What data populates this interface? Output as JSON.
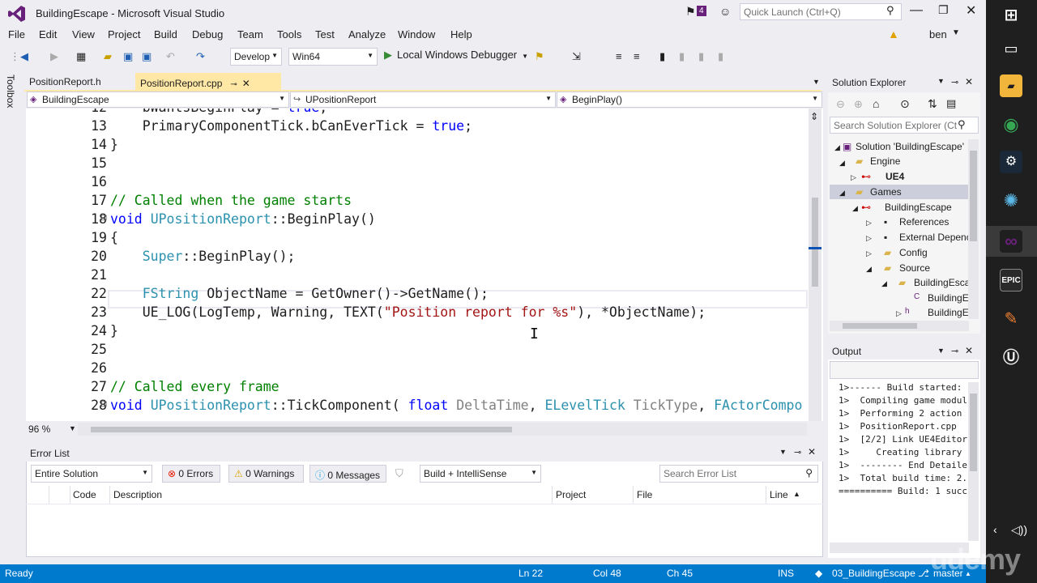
{
  "window": {
    "title": "BuildingEscape - Microsoft Visual Studio",
    "notification_count": "4",
    "quick_launch_placeholder": "Quick Launch (Ctrl+Q)",
    "user": "ben"
  },
  "menu": [
    "File",
    "Edit",
    "View",
    "Project",
    "Build",
    "Debug",
    "Team",
    "Tools",
    "Test",
    "Analyze",
    "Window",
    "Help"
  ],
  "toolbar": {
    "config": "Develop",
    "platform": "Win64",
    "run_label": "Local Windows Debugger"
  },
  "toolbox_label": "Toolbox",
  "tabs": {
    "header_file": "PositionReport.h",
    "active_file": "PositionReport.cpp"
  },
  "navbar": {
    "project": "BuildingEscape",
    "class": "UPositionReport",
    "member": "BeginPlay()"
  },
  "editor": {
    "zoom": "96 %",
    "lines": [
      {
        "n": "12",
        "segs": [
          [
            "tx",
            "    bWantsBeginPlay = "
          ],
          [
            "kw",
            "true"
          ],
          [
            "tx",
            ";"
          ]
        ]
      },
      {
        "n": "13",
        "segs": [
          [
            "tx",
            "    PrimaryComponentTick.bCanEverTick = "
          ],
          [
            "kw",
            "true"
          ],
          [
            "tx",
            ";"
          ]
        ]
      },
      {
        "n": "14",
        "segs": [
          [
            "tx",
            "}"
          ]
        ]
      },
      {
        "n": "15",
        "segs": []
      },
      {
        "n": "16",
        "segs": []
      },
      {
        "n": "17",
        "segs": [
          [
            "cm",
            "// Called when the game starts"
          ]
        ]
      },
      {
        "n": "18",
        "segs": [
          [
            "kw",
            "void"
          ],
          [
            "tx",
            " "
          ],
          [
            "ty",
            "UPositionReport"
          ],
          [
            "tx",
            "::BeginPlay()"
          ]
        ]
      },
      {
        "n": "19",
        "segs": [
          [
            "tx",
            "{"
          ]
        ]
      },
      {
        "n": "20",
        "segs": [
          [
            "tx",
            "    "
          ],
          [
            "ty",
            "Super"
          ],
          [
            "tx",
            "::BeginPlay();"
          ]
        ]
      },
      {
        "n": "21",
        "segs": []
      },
      {
        "n": "22",
        "segs": [
          [
            "tx",
            "    "
          ],
          [
            "ty",
            "FString"
          ],
          [
            "tx",
            " ObjectName = GetOwner()->GetName();"
          ]
        ]
      },
      {
        "n": "23",
        "segs": [
          [
            "tx",
            "    UE_LOG(LogTemp, Warning, TEXT("
          ],
          [
            "st",
            "\"Position report for %s\""
          ],
          [
            "tx",
            "), *ObjectName);"
          ]
        ]
      },
      {
        "n": "24",
        "segs": [
          [
            "tx",
            "}"
          ]
        ]
      },
      {
        "n": "25",
        "segs": []
      },
      {
        "n": "26",
        "segs": []
      },
      {
        "n": "27",
        "segs": [
          [
            "cm",
            "// Called every frame"
          ]
        ]
      },
      {
        "n": "28",
        "segs": [
          [
            "kw",
            "void"
          ],
          [
            "tx",
            " "
          ],
          [
            "ty",
            "UPositionReport"
          ],
          [
            "tx",
            "::TickComponent( "
          ],
          [
            "kw",
            "float"
          ],
          [
            "tx",
            " "
          ],
          [
            "pm",
            "DeltaTime"
          ],
          [
            "tx",
            ", "
          ],
          [
            "ty",
            "ELevelTick"
          ],
          [
            "tx",
            " "
          ],
          [
            "pm",
            "TickType"
          ],
          [
            "tx",
            ", "
          ],
          [
            "ty",
            "FActorCompo"
          ]
        ]
      }
    ]
  },
  "error_list": {
    "title": "Error List",
    "scope": "Entire Solution",
    "errors": "0 Errors",
    "warnings": "0 Warnings",
    "messages": "0 Messages",
    "filter": "Build + IntelliSense",
    "search_placeholder": "Search Error List",
    "columns": [
      "Code",
      "Description",
      "Project",
      "File",
      "Line"
    ]
  },
  "solution_explorer": {
    "title": "Solution Explorer",
    "search_placeholder": "Search Solution Explorer (Ct",
    "items": [
      {
        "label": "Solution 'BuildingEscape'",
        "bold": false
      },
      {
        "label": "Engine",
        "bold": false
      },
      {
        "label": "UE4",
        "bold": true
      },
      {
        "label": "Games",
        "bold": false
      },
      {
        "label": "BuildingEscape",
        "bold": false
      },
      {
        "label": "References",
        "bold": false
      },
      {
        "label": "External Depenc",
        "bold": false
      },
      {
        "label": "Config",
        "bold": false
      },
      {
        "label": "Source",
        "bold": false
      },
      {
        "label": "BuildingEsca",
        "bold": false
      },
      {
        "label": "BuildingE",
        "bold": false
      },
      {
        "label": "BuildingE",
        "bold": false
      }
    ]
  },
  "output": {
    "title": "Output",
    "lines": [
      "1>------ Build started:",
      "1>  Compiling game modul",
      "1>  Performing 2 action",
      "1>  PositionReport.cpp",
      "1>  [2/2] Link UE4Editor",
      "1>     Creating library",
      "1>  -------- End Detaile",
      "1>  Total build time: 2.",
      "========== Build: 1 succ"
    ]
  },
  "status": {
    "ready": "Ready",
    "ln": "Ln 22",
    "col": "Col 48",
    "ch": "Ch 45",
    "mode": "INS",
    "repo": "03_BuildingEscape",
    "branch": "master"
  },
  "taskbar": {
    "epic_label": "EPIC"
  },
  "watermark": "udemy"
}
